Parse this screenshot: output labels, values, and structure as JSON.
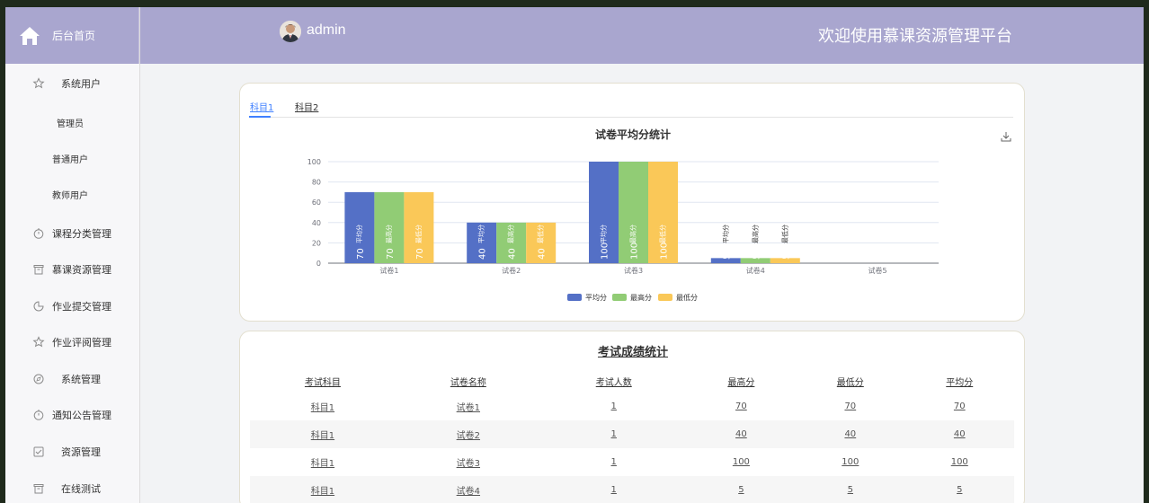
{
  "header": {
    "home_label": "后台首页",
    "user_name": "admin",
    "welcome": "欢迎使用慕课资源管理平台"
  },
  "sidebar": {
    "items": [
      {
        "label": "系统用户",
        "icon": "star-icon"
      },
      {
        "label": "课程分类管理",
        "icon": "clock-icon"
      },
      {
        "label": "慕课资源管理",
        "icon": "trash-icon"
      },
      {
        "label": "作业提交管理",
        "icon": "pie-icon"
      },
      {
        "label": "作业评阅管理",
        "icon": "star-icon"
      },
      {
        "label": "系统管理",
        "icon": "compass-icon"
      },
      {
        "label": "通知公告管理",
        "icon": "clock-icon"
      },
      {
        "label": "资源管理",
        "icon": "check-icon"
      },
      {
        "label": "在线测试",
        "icon": "trash-icon"
      }
    ],
    "sub_items": [
      "管理员",
      "普通用户",
      "教师用户"
    ]
  },
  "tabs": [
    "科目1",
    "科目2"
  ],
  "colors": {
    "series1": "#5470c6",
    "series2": "#91cc75",
    "series3": "#fac858",
    "header_bg": "#a9a6cf",
    "tab_active": "#4080ff"
  },
  "chart_data": {
    "type": "bar",
    "title": "试卷平均分统计",
    "categories": [
      "试卷1",
      "试卷2",
      "试卷3",
      "试卷4",
      "试卷5"
    ],
    "series": [
      {
        "name": "平均分",
        "values": [
          70,
          40,
          100,
          5,
          0
        ]
      },
      {
        "name": "最高分",
        "values": [
          70,
          40,
          100,
          5,
          0
        ]
      },
      {
        "name": "最低分",
        "values": [
          70,
          40,
          100,
          5,
          0
        ]
      }
    ],
    "ylim": [
      0,
      100
    ],
    "yticks": [
      0,
      20,
      40,
      60,
      80,
      100
    ],
    "legend": "bottom-center",
    "grid": true
  },
  "table": {
    "title": "考试成绩统计",
    "columns": [
      "考试科目",
      "试卷名称",
      "考试人数",
      "最高分",
      "最低分",
      "平均分"
    ],
    "rows": [
      [
        "科目1",
        "试卷1",
        "1",
        "70",
        "70",
        "70"
      ],
      [
        "科目1",
        "试卷2",
        "1",
        "40",
        "40",
        "40"
      ],
      [
        "科目1",
        "试卷3",
        "1",
        "100",
        "100",
        "100"
      ],
      [
        "科目1",
        "试卷4",
        "1",
        "5",
        "5",
        "5"
      ]
    ]
  }
}
